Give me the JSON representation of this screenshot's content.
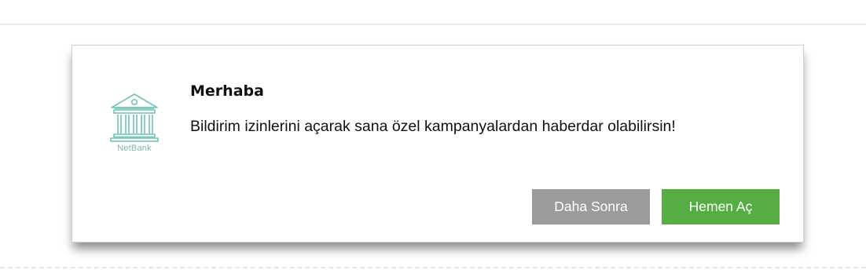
{
  "dialog": {
    "logo_text": "NetBank",
    "title": "Merhaba",
    "message": "Bildirim izinlerini açarak sana özel kampanyalardan haberdar olabilirsin!",
    "later_label": "Daha Sonra",
    "open_label": "Hemen Aç"
  },
  "colors": {
    "later_button": "#9b9b9b",
    "open_button": "#56ad43",
    "logo": "#6fc3b4"
  },
  "icons": {
    "logo": "bank-building-icon"
  }
}
